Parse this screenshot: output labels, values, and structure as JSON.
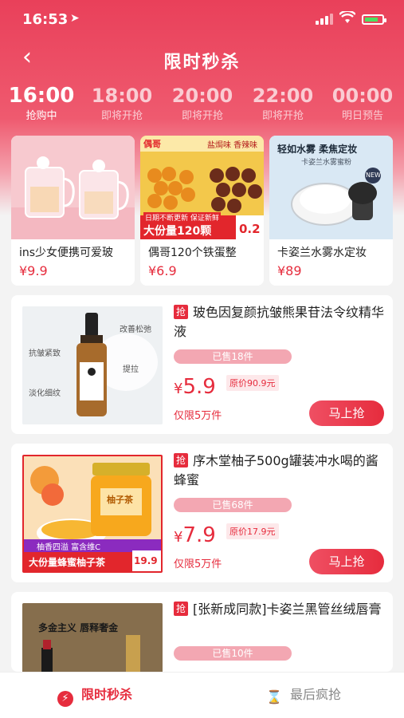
{
  "status_bar": {
    "time": "16:53",
    "location_glyph": "➤"
  },
  "nav": {
    "back_glyph": "‹",
    "title": "限时秒杀"
  },
  "time_tabs": [
    {
      "time": "16:00",
      "status": "抢购中",
      "active": true
    },
    {
      "time": "18:00",
      "status": "即将开抢",
      "active": false
    },
    {
      "time": "20:00",
      "status": "即将开抢",
      "active": false
    },
    {
      "time": "22:00",
      "status": "即将开抢",
      "active": false
    },
    {
      "time": "00:00",
      "status": "明日预告",
      "active": false
    }
  ],
  "featured": [
    {
      "name": "ins少女便携可爱玻",
      "price": "¥9.9",
      "image_icon": "glass-cup-image"
    },
    {
      "name": "偶哥120个铁蛋整",
      "price": "¥6.9",
      "image_icon": "iron-eggs-image",
      "image_text": {
        "brand": "偶哥",
        "flavor": "盐焗味 香辣味",
        "promo": "日期不断更新 保证新鲜",
        "big": "大份量120颗",
        "price": "0.2"
      }
    },
    {
      "name": "卡姿兰水雾水定妆",
      "price": "¥89",
      "image_icon": "setting-powder-image",
      "image_text": {
        "headline": "轻如水雾 柔焦定妆",
        "sub": "卡姿兰水雾蜜粉",
        "badge": "NEW"
      }
    }
  ],
  "deals": [
    {
      "badge": "抢",
      "title": "玻色因复颜抗皱熊果苷法令纹精华液",
      "sold": "已售18件",
      "currency": "¥",
      "price": "5.9",
      "original": "原价90.9元",
      "limit": "仅限5万件",
      "button": "马上抢",
      "image_icon": "serum-bottle-image",
      "image_text": {
        "l1": "抗皱紧致",
        "l2": "淡化细纹",
        "r1": "改善松弛",
        "r2": "提拉"
      }
    },
    {
      "badge": "抢",
      "title": "序木堂柚子500g罐装冲水喝的酱蜂蜜",
      "sold": "已售68件",
      "currency": "¥",
      "price": "7.9",
      "original": "原价17.9元",
      "limit": "仅限5万件",
      "button": "马上抢",
      "image_icon": "honey-jar-image",
      "image_text": {
        "jar": "柚子茶",
        "strip": "柚香四溢 富含维C",
        "big": "大份量蜂蜜柚子茶",
        "price": "19.9"
      }
    },
    {
      "badge": "抢",
      "title": "[张新成同款]卡姿兰黑管丝绒唇膏",
      "sold": "已售10件",
      "currency": "¥",
      "price": "",
      "original": "",
      "limit": "",
      "button": "",
      "image_icon": "lipstick-image",
      "image_text": {
        "line1": "多金主义 唇释奢金"
      }
    }
  ],
  "bottom_tabs": [
    {
      "label": "限时秒杀",
      "icon": "lightning-icon",
      "active": true
    },
    {
      "label": "最后疯抢",
      "icon": "hourglass-icon",
      "active": false
    }
  ],
  "colors": {
    "primary": "#e62c3d",
    "hero": "#e9405a",
    "sold_pill": "#f3a7b2"
  }
}
